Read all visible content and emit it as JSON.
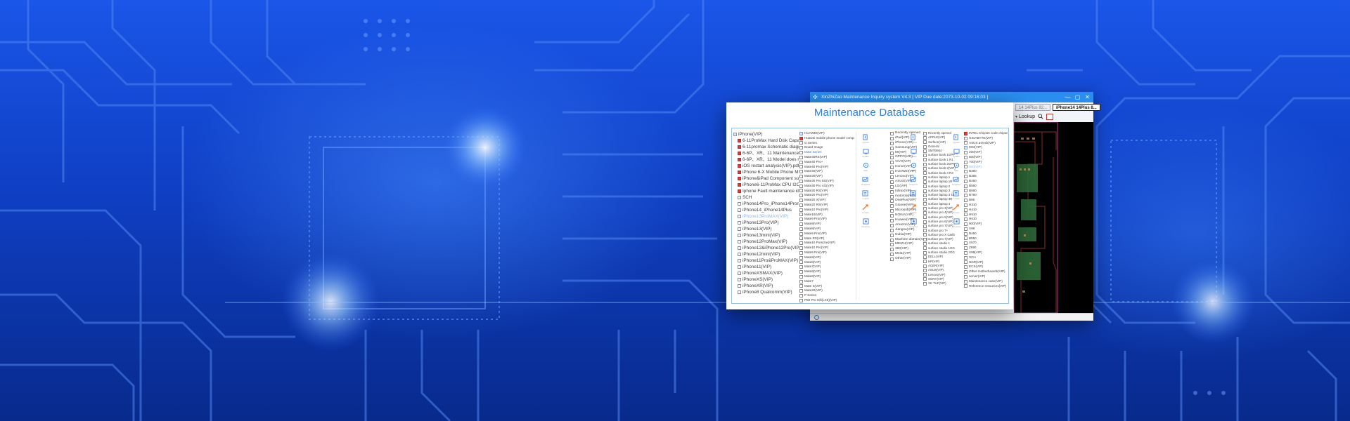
{
  "back_window": {
    "title": "XinZhiZao Maintenance Inquiry system V4.3 [ VIP Due date:2073-10-02 09:16:03 ]",
    "tabs": [
      {
        "label": "14 14Plus 82..."
      },
      {
        "label": "iPhone14 14Plus 8...",
        "active": true
      }
    ],
    "toolbar": {
      "lookup_label": "Lookup"
    },
    "window_controls": [
      "—",
      "▢",
      "✕"
    ]
  },
  "front_window": {
    "title": "Maintenance Database",
    "col1": [
      {
        "label": "iPhone(VIP)",
        "icon": "folder-open",
        "indent": 0
      },
      {
        "label": "6-11ProMax Hard Disk Capacity tab",
        "icon": "pdf",
        "indent": 1
      },
      {
        "label": "6-11promax Schematic diagram of",
        "icon": "pdf",
        "indent": 1
      },
      {
        "label": "6-6P、XR、11 Maintenance of Scre",
        "icon": "pdf",
        "indent": 1
      },
      {
        "label": "6-6P、XR、11 Model does not show",
        "icon": "pdf",
        "indent": 1
      },
      {
        "label": "iOS restart analysis(VIP).pdf",
        "icon": "pdf",
        "indent": 1
      },
      {
        "label": "iPhone 6-X Mobile Phone Mainten",
        "icon": "pdf",
        "indent": 1
      },
      {
        "label": "iPhone&iPad Component substituti",
        "icon": "pdf",
        "indent": 1
      },
      {
        "label": "iPhone6-11ProMax CPU I2C bus Pa",
        "icon": "pdf",
        "indent": 1
      },
      {
        "label": "Iphone Fault maintenance idea(VIP",
        "icon": "pdf",
        "indent": 1
      },
      {
        "label": "SCH",
        "icon": "box",
        "indent": 1
      },
      {
        "label": "iPhone14Pro_iPhone14Promax",
        "icon": "box",
        "indent": 1
      },
      {
        "label": "iPhone14_iPhone14Plus",
        "icon": "box",
        "indent": 1
      },
      {
        "label": "iPhone13ProMAX(VIP)",
        "icon": "box",
        "indent": 1,
        "state": "highlight"
      },
      {
        "label": "iPhone13Pro(VIP)",
        "icon": "box",
        "indent": 1
      },
      {
        "label": "iPhone13(VIP)",
        "icon": "box",
        "indent": 1
      },
      {
        "label": "iPhone13mini(VIP)",
        "icon": "box",
        "indent": 1
      },
      {
        "label": "iPhone12ProMax(VIP)",
        "icon": "box",
        "indent": 1
      },
      {
        "label": "iPhone12&iPhone12Pro(VIP)",
        "icon": "box",
        "indent": 1
      },
      {
        "label": "iPhone12mini(VIP)",
        "icon": "box",
        "indent": 1
      },
      {
        "label": "iPhone11Pro&ProMAX(VIP)",
        "icon": "box",
        "indent": 1
      },
      {
        "label": "iPhone11(VIP)",
        "icon": "box",
        "indent": 1
      },
      {
        "label": "iPhoneXSMAX(VIP)",
        "icon": "box",
        "indent": 1
      },
      {
        "label": "iPhoneXS(VIP)",
        "icon": "box",
        "indent": 1
      },
      {
        "label": "iPhoneXR(VIP)",
        "icon": "box",
        "indent": 1
      },
      {
        "label": "iPhone8 Qualcomm(VIP)",
        "icon": "box",
        "indent": 1
      }
    ],
    "col2": [
      {
        "label": "HUAWEI(VIP)",
        "icon": "folder-open"
      },
      {
        "label": "Huawei mobile phone model comparis",
        "icon": "pdf"
      },
      {
        "label": "G Series",
        "icon": "box"
      },
      {
        "label": "Board Image",
        "icon": "box"
      },
      {
        "label": "Mate Series",
        "icon": "box",
        "state": "sel"
      },
      {
        "label": "Mate40RS(VIP)",
        "icon": "box"
      },
      {
        "label": "Mate40 Pro+",
        "icon": "box"
      },
      {
        "label": "Mate40 Pro(VIP)",
        "icon": "box"
      },
      {
        "label": "Mate40(VIP)",
        "icon": "box"
      },
      {
        "label": "Mate30(VIP)",
        "icon": "box"
      },
      {
        "label": "Mate30 Pro 5G(VIP)",
        "icon": "box"
      },
      {
        "label": "Mate30 Pro 4G(VIP)",
        "icon": "box"
      },
      {
        "label": "Mate30 RS(VIP)",
        "icon": "box"
      },
      {
        "label": "Mate20 Pro(VIP)",
        "icon": "box"
      },
      {
        "label": "Mate20 X(VIP)",
        "icon": "box"
      },
      {
        "label": "Mate20 RS(VIP)",
        "icon": "box"
      },
      {
        "label": "Mate10 Pro(VIP)",
        "icon": "box"
      },
      {
        "label": "Mate10(VIP)",
        "icon": "box"
      },
      {
        "label": "Mate9 Pro(VIP)",
        "icon": "box"
      },
      {
        "label": "Mate9(VIP)",
        "icon": "box"
      },
      {
        "label": "Mate8(VIP)",
        "icon": "box"
      },
      {
        "label": "Mate9 Pro(VIP)",
        "icon": "box"
      },
      {
        "label": "Mate RS(VIP)",
        "icon": "box"
      },
      {
        "label": "Mate10 Porsche(VIP)",
        "icon": "box"
      },
      {
        "label": "Mate10 Pro(VIP)",
        "icon": "box"
      },
      {
        "label": "Mate9 Pro(VIP)",
        "icon": "box"
      },
      {
        "label": "Mate9(VIP)",
        "icon": "box"
      },
      {
        "label": "Mate8(VIP)",
        "icon": "box"
      },
      {
        "label": "Mate7(VIP)",
        "icon": "box"
      },
      {
        "label": "Mate9(VIP)",
        "icon": "box"
      },
      {
        "label": "Mate8(VIP)",
        "icon": "box"
      },
      {
        "label": "Mate7",
        "icon": "box"
      },
      {
        "label": "Mate S(VIP)",
        "icon": "box"
      },
      {
        "label": "Mate20(VIP)",
        "icon": "box"
      },
      {
        "label": "P Series",
        "icon": "box"
      },
      {
        "label": "P50 Pro Hifi(LX9)(VIP)",
        "icon": "box"
      },
      {
        "label": "P50",
        "icon": "box"
      },
      {
        "label": "P40 Pro+(VIP)",
        "icon": "box"
      },
      {
        "label": "P40 Pro(VIP)",
        "icon": "box"
      },
      {
        "label": "P40(VIP)",
        "icon": "box"
      }
    ],
    "sidebar_labels": [
      "Upload",
      "Update",
      "Mall",
      "Graphics",
      "C.Auth",
      "Locate",
      "Favorites"
    ],
    "col3": [
      {
        "label": "Recently opened",
        "icon": "box"
      },
      {
        "label": "iPad(VIP)",
        "icon": "box"
      },
      {
        "label": "iPhone(VIP)",
        "icon": "box"
      },
      {
        "label": "Samsung(VIP)",
        "icon": "box"
      },
      {
        "label": "MI(VIP)",
        "icon": "box"
      },
      {
        "label": "OPPO(VIP)",
        "icon": "box"
      },
      {
        "label": "VIVO(VIP)",
        "icon": "box"
      },
      {
        "label": "Honor(VIP)",
        "icon": "box"
      },
      {
        "label": "HUAWEI(VIP)",
        "icon": "box"
      },
      {
        "label": "Lenovo(VIP)",
        "icon": "box"
      },
      {
        "label": "ASUS(VIP)",
        "icon": "box"
      },
      {
        "label": "LG(VIP)",
        "icon": "box"
      },
      {
        "label": "Infinix(VIP)",
        "icon": "box"
      },
      {
        "label": "motorola(VIP)",
        "icon": "box"
      },
      {
        "label": "OnePlus(VIP)",
        "icon": "box"
      },
      {
        "label": "Gionee(VIP)",
        "icon": "box"
      },
      {
        "label": "Microsoft(VIP)",
        "icon": "box"
      },
      {
        "label": "NOKIA(VIP)",
        "icon": "box"
      },
      {
        "label": "Huawei(VIP)",
        "icon": "box"
      },
      {
        "label": "Amazon(VIP)",
        "icon": "box"
      },
      {
        "label": "Jiangsu(VIP)",
        "icon": "box"
      },
      {
        "label": "Nubia(VIP)",
        "icon": "box"
      },
      {
        "label": "Machine domain(VIP)",
        "icon": "box"
      },
      {
        "label": "MEIZU(VIP)",
        "icon": "box"
      },
      {
        "label": "360(VIP)",
        "icon": "box"
      },
      {
        "label": "Meitu(VIP)",
        "icon": "box"
      },
      {
        "label": "Other(VIP)",
        "icon": "box"
      }
    ],
    "col4": [
      {
        "label": "Recently opened",
        "icon": "box"
      },
      {
        "label": "APPLE(VIP)",
        "icon": "box"
      },
      {
        "label": "Surface(VIP)",
        "icon": "box"
      },
      {
        "label": "General",
        "icon": "box"
      },
      {
        "label": "SMTB944",
        "icon": "box"
      },
      {
        "label": "surface book 1GPP",
        "icon": "box"
      },
      {
        "label": "surface book 1 R1",
        "icon": "box"
      },
      {
        "label": "surface book 2GPP",
        "icon": "box"
      },
      {
        "label": "surface book 2(VIP)",
        "icon": "box"
      },
      {
        "label": "surface book 3 R3",
        "icon": "box"
      },
      {
        "label": "surface laptop 1",
        "icon": "box"
      },
      {
        "label": "surface laptop 1R",
        "icon": "box"
      },
      {
        "label": "surface laptop 2",
        "icon": "box"
      },
      {
        "label": "surface laptop 3",
        "icon": "box"
      },
      {
        "label": "surface laptop 3 15",
        "icon": "box"
      },
      {
        "label": "surface laptop 3R",
        "icon": "box"
      },
      {
        "label": "surface laptop 4",
        "icon": "box"
      },
      {
        "label": "surface pro 3(VIP)",
        "icon": "box"
      },
      {
        "label": "surface pro 4(VIP)",
        "icon": "box"
      },
      {
        "label": "surface pro 5(VIP)",
        "icon": "box"
      },
      {
        "label": "surface pro 6(VIP)",
        "icon": "box"
      },
      {
        "label": "surface pro 7(VIP)",
        "icon": "box"
      },
      {
        "label": "surface pro 7+",
        "icon": "box"
      },
      {
        "label": "surface pro X Carib",
        "icon": "box"
      },
      {
        "label": "surface pro 7(VIP)",
        "icon": "box"
      },
      {
        "label": "surface studio 1",
        "icon": "box"
      },
      {
        "label": "surface studio 1GG",
        "icon": "box"
      },
      {
        "label": "surface studio 2GG",
        "icon": "box"
      },
      {
        "label": "DELL(VIP)",
        "icon": "box"
      },
      {
        "label": "HP(VIP)",
        "icon": "box"
      },
      {
        "label": "ACER(VIP)",
        "icon": "box"
      },
      {
        "label": "ASUS(VIP)",
        "icon": "box"
      },
      {
        "label": "Lenovo(VIP)",
        "icon": "box"
      },
      {
        "label": "SONY(VIP)",
        "icon": "box"
      },
      {
        "label": "XK TUF(VIP)",
        "icon": "box"
      }
    ],
    "col5": [
      {
        "label": "INTEL Chipset code chipset code",
        "icon": "pdf"
      },
      {
        "label": "GIGABYTE(VIP)",
        "icon": "box"
      },
      {
        "label": "ASUS asrock(VIP)",
        "icon": "box"
      },
      {
        "label": "MSI(VIP)",
        "icon": "folder-open"
      },
      {
        "label": "400(VIP)",
        "icon": "box"
      },
      {
        "label": "500(VIP)",
        "icon": "box"
      },
      {
        "label": "700(VIP)",
        "icon": "box"
      },
      {
        "label": "800(VIP)",
        "icon": "box",
        "state": "highlight"
      },
      {
        "label": "B360",
        "icon": "box"
      },
      {
        "label": "B365",
        "icon": "box"
      },
      {
        "label": "B460",
        "icon": "box"
      },
      {
        "label": "B560",
        "icon": "box"
      },
      {
        "label": "B660",
        "icon": "box"
      },
      {
        "label": "B760",
        "icon": "box"
      },
      {
        "label": "B85",
        "icon": "box"
      },
      {
        "label": "H310",
        "icon": "box"
      },
      {
        "label": "H410",
        "icon": "box"
      },
      {
        "label": "H510",
        "icon": "box"
      },
      {
        "label": "H610",
        "icon": "box"
      },
      {
        "label": "900(VIP)",
        "icon": "box"
      },
      {
        "label": "X99",
        "icon": "box"
      },
      {
        "label": "B450",
        "icon": "box"
      },
      {
        "label": "B550",
        "icon": "box"
      },
      {
        "label": "X570",
        "icon": "box"
      },
      {
        "label": "Z690",
        "icon": "box"
      },
      {
        "label": "X99(VIP)",
        "icon": "box"
      },
      {
        "label": "SCH",
        "icon": "box"
      },
      {
        "label": "NDR(VIP)",
        "icon": "box"
      },
      {
        "label": "ECS(VIP)",
        "icon": "box"
      },
      {
        "label": "Other motherboards(VIP)",
        "icon": "box"
      },
      {
        "label": "server(VIP)",
        "icon": "box"
      },
      {
        "label": "Maintenance case(VIP)",
        "icon": "box"
      },
      {
        "label": "Reference resources(VIP)",
        "icon": "box"
      }
    ]
  },
  "colors": {
    "accent_blue": "#2b7de0",
    "titlebar_blue": "#2a8ef0",
    "pdf_red": "#e23b3b",
    "pcb_trace": "#9b2a2a",
    "background_blue": "#0f3fc4"
  }
}
